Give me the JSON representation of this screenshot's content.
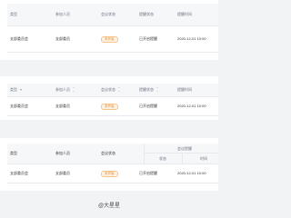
{
  "table1": {
    "headers": [
      "类型",
      "参加人员",
      "会议状态",
      "提醒状态",
      "提醒时间"
    ],
    "row": {
      "type": "支部委员会",
      "attendees": "支部委员",
      "status": "未开始",
      "reminder_status": "已开启提醒",
      "reminder_time": "2020-12-01 10:00"
    }
  },
  "table2": {
    "headers": [
      "类型",
      "参加人员",
      "会议状态",
      "提醒状态",
      "提醒时间"
    ],
    "icons": {
      "type_header": "filter-icon",
      "attendees_header": "sort-icon",
      "status_header": "sort-icon",
      "reminder_header": "sort-icon"
    },
    "row": {
      "type": "支部委员会",
      "attendees": "支部委员",
      "status": "未开始",
      "reminder_status": "已开启提醒",
      "reminder_time": "2020-12-01 10:00"
    }
  },
  "table3": {
    "headers": [
      "类型",
      "参加人员",
      "会议状态"
    ],
    "group_header": "会议提醒",
    "sub_headers": [
      "状态",
      "时间"
    ],
    "row": {
      "type": "支部委员会",
      "attendees": "支部委员",
      "status": "未开始",
      "reminder_status": "已开启提醒",
      "reminder_time": "2020-12-01 10:00"
    }
  },
  "watermark": "@大星星",
  "colors": {
    "background": "#f2f3f5",
    "card": "#ffffff",
    "header_bg": "#f6f7f9",
    "badge_text": "#e08a2b",
    "badge_bg": "#fff3e6"
  }
}
